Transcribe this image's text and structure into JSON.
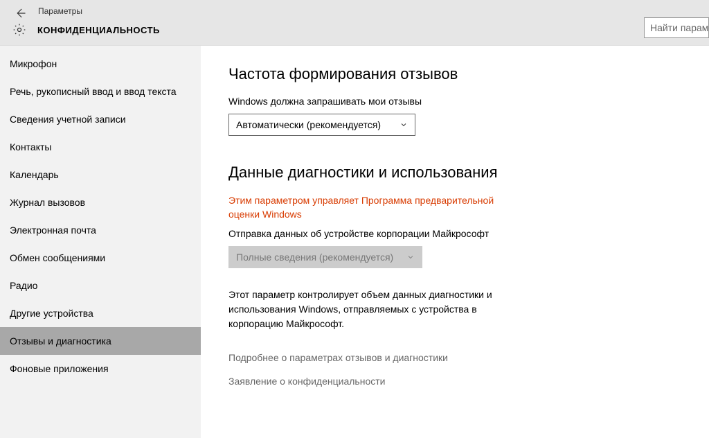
{
  "header": {
    "window_title": "Параметры",
    "section_title": "КОНФИДЕНЦИАЛЬНОСТЬ",
    "search_placeholder": "Найти параме"
  },
  "sidebar": {
    "items": [
      {
        "label": "Микрофон",
        "selected": false
      },
      {
        "label": "Речь, рукописный ввод и ввод текста",
        "selected": false
      },
      {
        "label": "Сведения учетной записи",
        "selected": false
      },
      {
        "label": "Контакты",
        "selected": false
      },
      {
        "label": "Календарь",
        "selected": false
      },
      {
        "label": "Журнал вызовов",
        "selected": false
      },
      {
        "label": "Электронная почта",
        "selected": false
      },
      {
        "label": "Обмен сообщениями",
        "selected": false
      },
      {
        "label": "Радио",
        "selected": false
      },
      {
        "label": "Другие устройства",
        "selected": false
      },
      {
        "label": "Отзывы и диагностика",
        "selected": true
      },
      {
        "label": "Фоновые приложения",
        "selected": false
      }
    ]
  },
  "main": {
    "feedback": {
      "heading": "Частота формирования отзывов",
      "label": "Windows должна запрашивать мои отзывы",
      "dropdown_value": "Автоматически (рекомендуется)"
    },
    "diagnostics": {
      "heading": "Данные диагностики и использования",
      "notice": "Этим параметром управляет Программа предварительной оценки Windows",
      "label": "Отправка данных об устройстве корпорации Майкрософт",
      "dropdown_value": "Полные сведения (рекомендуется)",
      "description": "Этот параметр контролирует объем данных диагностики и использования Windows, отправляемых с устройства в корпорацию Майкрософт."
    },
    "links": {
      "learn_more": "Подробнее о параметрах отзывов и диагностики",
      "privacy_statement": "Заявление о конфиденциальности"
    }
  }
}
